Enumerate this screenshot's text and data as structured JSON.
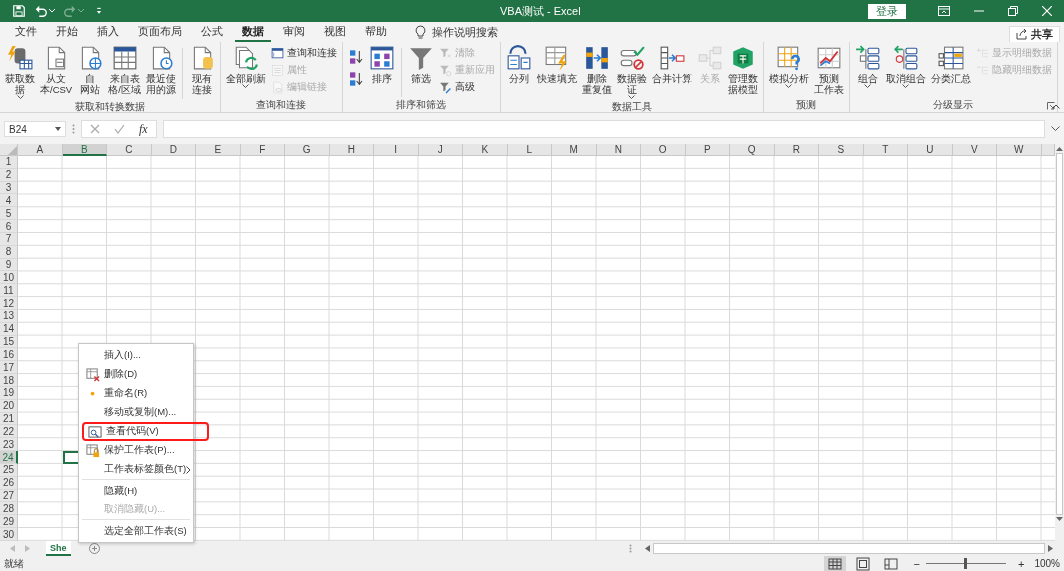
{
  "title_bar": {
    "quick_access": [
      {
        "disabled": false,
        "dropdown": false
      },
      {
        "disabled": false,
        "dropdown": true
      },
      {
        "disabled": true,
        "dropdown": true
      },
      {
        "disabled": false,
        "dropdown": false
      }
    ],
    "title": "VBA测试 - Excel",
    "sign_in": "登录"
  },
  "tabs": [
    {
      "label": "文件",
      "selected": false
    },
    {
      "label": "开始",
      "selected": false
    },
    {
      "label": "插入",
      "selected": false
    },
    {
      "label": "页面布局",
      "selected": false
    },
    {
      "label": "公式",
      "selected": false
    },
    {
      "label": "数据",
      "selected": true
    },
    {
      "label": "审阅",
      "selected": false
    },
    {
      "label": "视图",
      "selected": false
    },
    {
      "label": "帮助",
      "selected": false
    }
  ],
  "tell_me": "操作说明搜索",
  "share": "共享",
  "ribbon": [
    {
      "label": "获取和转换数据",
      "dialog_launcher": false,
      "items": [
        {
          "kind": "large",
          "lines": [
            "获取数",
            "据"
          ],
          "dropdown": true,
          "disabled": false
        },
        {
          "kind": "large",
          "lines": [
            "从文",
            "本/CSV"
          ],
          "dropdown": false,
          "disabled": false
        },
        {
          "kind": "large",
          "lines": [
            "自",
            "网站"
          ],
          "dropdown": false,
          "disabled": false
        },
        {
          "kind": "large",
          "lines": [
            "来自表",
            "格/区域"
          ],
          "dropdown": false,
          "disabled": false
        },
        {
          "kind": "large",
          "lines": [
            "最近使",
            "用的源"
          ],
          "dropdown": false,
          "disabled": false
        },
        {
          "kind": "separator"
        },
        {
          "kind": "large",
          "lines": [
            "现有",
            "连接"
          ],
          "dropdown": false,
          "disabled": false
        }
      ]
    },
    {
      "label": "查询和连接",
      "dialog_launcher": false,
      "items": [
        {
          "kind": "large",
          "lines": [
            "全部刷新"
          ],
          "dropdown": true,
          "disabled": false
        },
        {
          "kind": "stack",
          "items": [
            {
              "label": "查询和连接",
              "disabled": false
            },
            {
              "label": "属性",
              "disabled": true
            },
            {
              "label": "编辑链接",
              "disabled": true
            }
          ]
        }
      ]
    },
    {
      "label": "排序和筛选",
      "dialog_launcher": false,
      "items": [
        {
          "kind": "stack",
          "items": [
            {
              "disabled": false
            },
            {
              "disabled": false
            }
          ]
        },
        {
          "kind": "large",
          "lines": [
            "排序"
          ],
          "dropdown": false,
          "disabled": false
        },
        {
          "kind": "separator"
        },
        {
          "kind": "large",
          "lines": [
            "筛选"
          ],
          "dropdown": false,
          "disabled": false
        },
        {
          "kind": "stack",
          "items": [
            {
              "label": "清除",
              "disabled": true
            },
            {
              "label": "重新应用",
              "disabled": true
            },
            {
              "label": "高级",
              "disabled": false
            }
          ]
        }
      ]
    },
    {
      "label": "数据工具",
      "dialog_launcher": false,
      "items": [
        {
          "kind": "large",
          "lines": [
            "分列"
          ],
          "dropdown": false,
          "disabled": false
        },
        {
          "kind": "large",
          "lines": [
            "快速填充"
          ],
          "dropdown": false,
          "disabled": false
        },
        {
          "kind": "large",
          "lines": [
            "删除",
            "重复值"
          ],
          "dropdown": false,
          "disabled": false
        },
        {
          "kind": "large",
          "lines": [
            "数据验",
            "证"
          ],
          "dropdown": true,
          "disabled": false
        },
        {
          "kind": "large",
          "lines": [
            "合并计算"
          ],
          "dropdown": false,
          "disabled": false
        },
        {
          "kind": "large",
          "lines": [
            "关系"
          ],
          "dropdown": false,
          "disabled": true
        },
        {
          "kind": "large",
          "lines": [
            "管理数",
            "据模型"
          ],
          "dropdown": false,
          "disabled": false
        }
      ]
    },
    {
      "label": "预测",
      "dialog_launcher": false,
      "items": [
        {
          "kind": "large",
          "lines": [
            "模拟分析"
          ],
          "dropdown": true,
          "disabled": false
        },
        {
          "kind": "large",
          "lines": [
            "预测",
            "工作表"
          ],
          "dropdown": false,
          "disabled": false
        }
      ]
    },
    {
      "label": "分级显示",
      "dialog_launcher": true,
      "items": [
        {
          "kind": "large",
          "lines": [
            "组合"
          ],
          "dropdown": true,
          "disabled": false
        },
        {
          "kind": "large",
          "lines": [
            "取消组合"
          ],
          "dropdown": true,
          "disabled": false
        },
        {
          "kind": "large",
          "lines": [
            "分类汇总"
          ],
          "dropdown": false,
          "disabled": false
        },
        {
          "kind": "stack",
          "items": [
            {
              "label": "显示明细数据",
              "disabled": true
            },
            {
              "label": "隐藏明细数据",
              "disabled": true
            }
          ]
        }
      ]
    }
  ],
  "formula_bar": {
    "name_box": "B24",
    "fx": "fx"
  },
  "sheet": {
    "columns": [
      {
        "label": "A",
        "selected": false
      },
      {
        "label": "B",
        "selected": true
      },
      {
        "label": "C",
        "selected": false
      },
      {
        "label": "D",
        "selected": false
      },
      {
        "label": "E",
        "selected": false
      },
      {
        "label": "F",
        "selected": false
      },
      {
        "label": "G",
        "selected": false
      },
      {
        "label": "H",
        "selected": false
      },
      {
        "label": "I",
        "selected": false
      },
      {
        "label": "J",
        "selected": false
      },
      {
        "label": "K",
        "selected": false
      },
      {
        "label": "L",
        "selected": false
      },
      {
        "label": "M",
        "selected": false
      },
      {
        "label": "N",
        "selected": false
      },
      {
        "label": "O",
        "selected": false
      },
      {
        "label": "P",
        "selected": false
      },
      {
        "label": "Q",
        "selected": false
      },
      {
        "label": "R",
        "selected": false
      },
      {
        "label": "S",
        "selected": false
      },
      {
        "label": "T",
        "selected": false
      },
      {
        "label": "U",
        "selected": false
      },
      {
        "label": "V",
        "selected": false
      },
      {
        "label": "W",
        "selected": false
      }
    ],
    "rows": [
      {
        "label": "1",
        "selected": false
      },
      {
        "label": "2",
        "selected": false
      },
      {
        "label": "3",
        "selected": false
      },
      {
        "label": "4",
        "selected": false
      },
      {
        "label": "5",
        "selected": false
      },
      {
        "label": "6",
        "selected": false
      },
      {
        "label": "7",
        "selected": false
      },
      {
        "label": "8",
        "selected": false
      },
      {
        "label": "9",
        "selected": false
      },
      {
        "label": "10",
        "selected": false
      },
      {
        "label": "11",
        "selected": false
      },
      {
        "label": "12",
        "selected": false
      },
      {
        "label": "13",
        "selected": false
      },
      {
        "label": "14",
        "selected": false
      },
      {
        "label": "15",
        "selected": false
      },
      {
        "label": "16",
        "selected": false
      },
      {
        "label": "17",
        "selected": false
      },
      {
        "label": "18",
        "selected": false
      },
      {
        "label": "19",
        "selected": false
      },
      {
        "label": "20",
        "selected": false
      },
      {
        "label": "21",
        "selected": false
      },
      {
        "label": "22",
        "selected": false
      },
      {
        "label": "23",
        "selected": false
      },
      {
        "label": "24",
        "selected": true
      },
      {
        "label": "25",
        "selected": false
      },
      {
        "label": "26",
        "selected": false
      },
      {
        "label": "27",
        "selected": false
      },
      {
        "label": "28",
        "selected": false
      },
      {
        "label": "29",
        "selected": false
      },
      {
        "label": "30",
        "selected": false
      }
    ]
  },
  "context_menu": [
    {
      "label": "插入(I)...",
      "disabled": false,
      "separator_before": false,
      "submenu": false,
      "highlighted": false
    },
    {
      "label": "删除(D)",
      "disabled": false,
      "separator_before": false,
      "submenu": false,
      "highlighted": false
    },
    {
      "label": "重命名(R)",
      "disabled": false,
      "separator_before": false,
      "submenu": false,
      "highlighted": false
    },
    {
      "label": "移动或复制(M)...",
      "disabled": false,
      "separator_before": false,
      "submenu": false,
      "highlighted": false
    },
    {
      "label": "查看代码(V)",
      "disabled": false,
      "separator_before": false,
      "submenu": false,
      "highlighted": true
    },
    {
      "label": "保护工作表(P)...",
      "disabled": false,
      "separator_before": false,
      "submenu": false,
      "highlighted": false
    },
    {
      "label": "工作表标签颜色(T)",
      "disabled": false,
      "separator_before": false,
      "submenu": true,
      "highlighted": false
    },
    {
      "label": "隐藏(H)",
      "disabled": false,
      "separator_before": true,
      "submenu": false,
      "highlighted": false
    },
    {
      "label": "取消隐藏(U)...",
      "disabled": true,
      "separator_before": false,
      "submenu": false,
      "highlighted": false
    },
    {
      "label": "选定全部工作表(S)",
      "disabled": false,
      "separator_before": true,
      "submenu": false,
      "highlighted": false
    }
  ],
  "sheet_tabs": [
    {
      "label": "She",
      "selected": true
    }
  ],
  "status_bar": {
    "status": "就绪",
    "views": [
      {
        "selected": true
      },
      {
        "selected": false
      },
      {
        "selected": false
      }
    ],
    "zoom_out": "−",
    "zoom_in": "+",
    "zoom": {
      "level": 0.5,
      "label": "100%"
    }
  }
}
